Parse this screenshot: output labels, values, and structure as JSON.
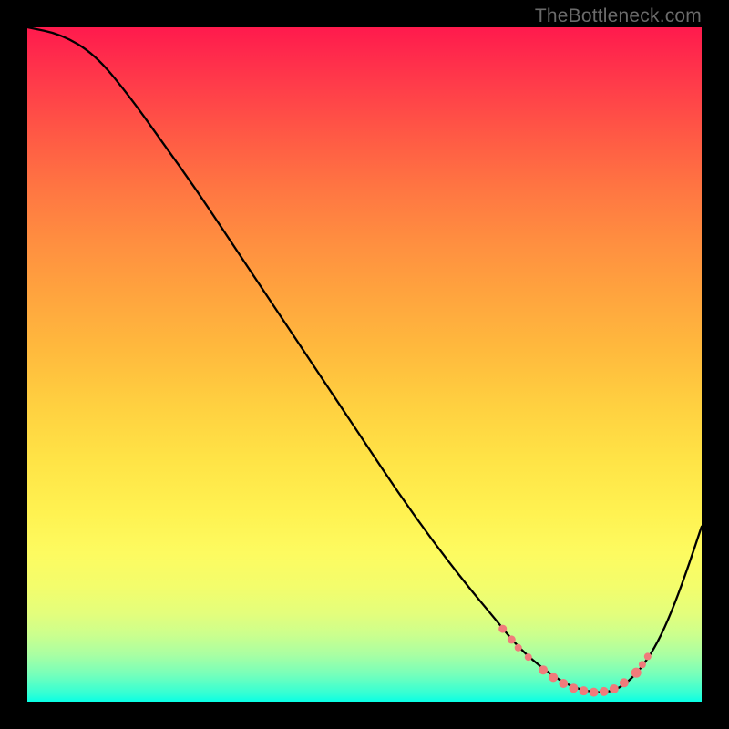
{
  "watermark": "TheBottleneck.com",
  "chart_data": {
    "type": "line",
    "title": "",
    "xlabel": "",
    "ylabel": "",
    "x_range": [
      0,
      100
    ],
    "y_range": [
      0,
      100
    ],
    "background_gradient": {
      "top": "#ff1a4d",
      "mid": "#ffe346",
      "bottom": "#08ffe5"
    },
    "curve": {
      "description": "Bottleneck curve: performance mismatch vs component balance. High at left, minimum near x≈80, rises again toward right.",
      "x": [
        0,
        5,
        10,
        15,
        20,
        25,
        30,
        35,
        40,
        45,
        50,
        55,
        60,
        65,
        70,
        72,
        74,
        76,
        78,
        80,
        82,
        84,
        86,
        88,
        90,
        92,
        94,
        96,
        98,
        100
      ],
      "y": [
        100,
        99,
        96,
        90,
        83,
        76,
        68.5,
        61,
        53.5,
        46,
        38.5,
        31,
        24,
        17.5,
        11.5,
        9,
        7,
        5.3,
        3.8,
        2.6,
        1.8,
        1.4,
        1.4,
        2.1,
        3.8,
        6.3,
        9.8,
        14.5,
        20,
        26
      ]
    },
    "markers": {
      "color": "#f07b7b",
      "radius_range": [
        3.5,
        6
      ],
      "points": [
        {
          "x": 70.5,
          "y": 10.8,
          "r": 4.5
        },
        {
          "x": 71.8,
          "y": 9.2,
          "r": 4.5
        },
        {
          "x": 72.8,
          "y": 8.0,
          "r": 4.0
        },
        {
          "x": 74.3,
          "y": 6.6,
          "r": 4.0
        },
        {
          "x": 76.5,
          "y": 4.7,
          "r": 5.0
        },
        {
          "x": 78.0,
          "y": 3.6,
          "r": 5.0
        },
        {
          "x": 79.5,
          "y": 2.7,
          "r": 5.0
        },
        {
          "x": 81.0,
          "y": 2.0,
          "r": 5.0
        },
        {
          "x": 82.5,
          "y": 1.6,
          "r": 5.0
        },
        {
          "x": 84.0,
          "y": 1.4,
          "r": 5.0
        },
        {
          "x": 85.5,
          "y": 1.5,
          "r": 5.0
        },
        {
          "x": 87.0,
          "y": 1.9,
          "r": 5.0
        },
        {
          "x": 88.5,
          "y": 2.8,
          "r": 5.0
        },
        {
          "x": 90.3,
          "y": 4.3,
          "r": 5.5
        },
        {
          "x": 91.2,
          "y": 5.5,
          "r": 4.0
        },
        {
          "x": 92.0,
          "y": 6.7,
          "r": 4.0
        }
      ]
    }
  }
}
